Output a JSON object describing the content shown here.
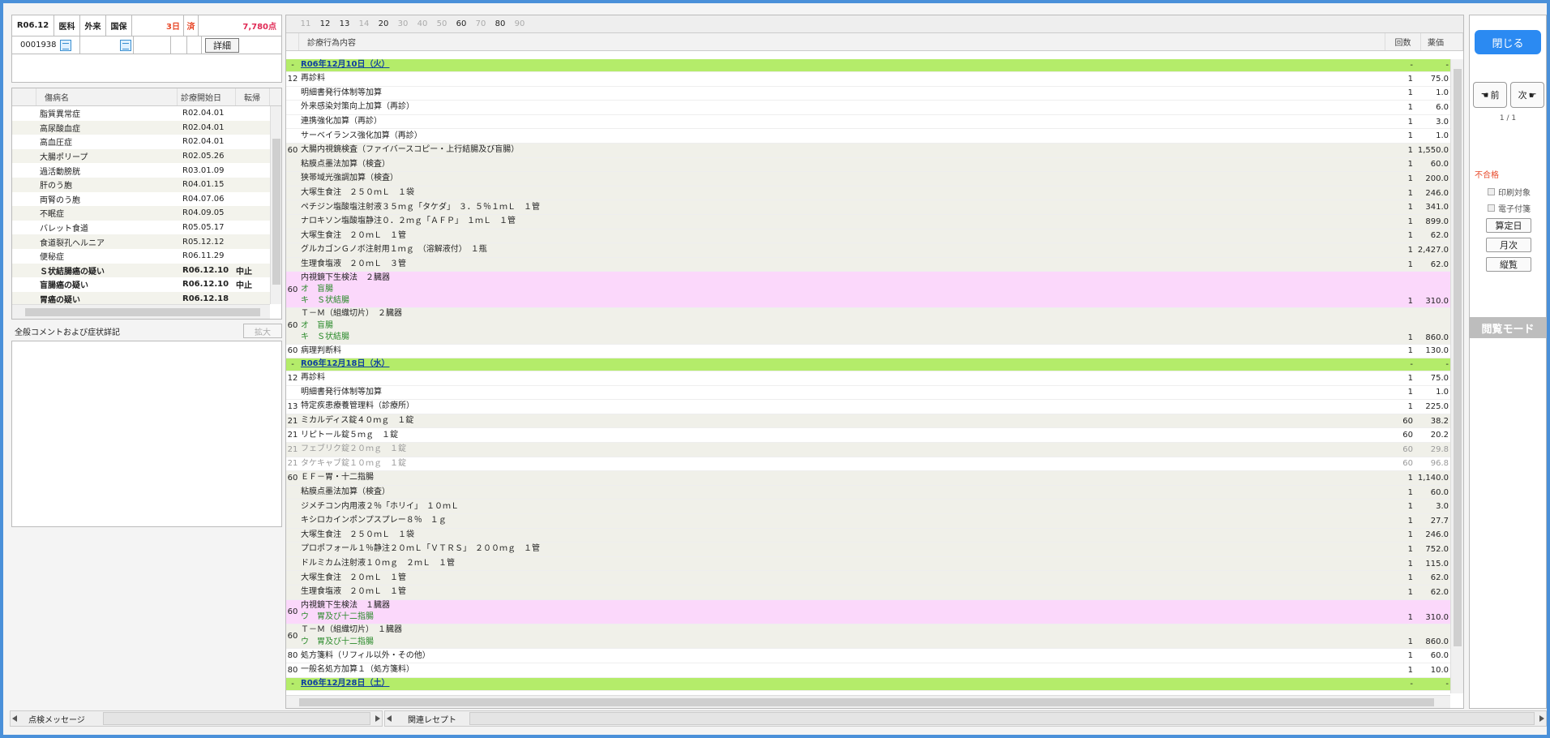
{
  "header": {
    "month": "R06.12",
    "type": "医科",
    "inout": "外来",
    "insurance": "国保",
    "days": "3日",
    "status": "済",
    "points": "7,780点",
    "patient_id": "0001938",
    "detail_label": "詳細"
  },
  "disease_table": {
    "headers": [
      "傷病名",
      "診療開始日",
      "転帰"
    ],
    "rows": [
      {
        "name": "脂質異常症",
        "date": "R02.04.01",
        "outcome": "",
        "bold": false
      },
      {
        "name": "高尿酸血症",
        "date": "R02.04.01",
        "outcome": "",
        "bold": false
      },
      {
        "name": "高血圧症",
        "date": "R02.04.01",
        "outcome": "",
        "bold": false
      },
      {
        "name": "大腸ポリープ",
        "date": "R02.05.26",
        "outcome": "",
        "bold": false
      },
      {
        "name": "過活動膀胱",
        "date": "R03.01.09",
        "outcome": "",
        "bold": false
      },
      {
        "name": "肝のう胞",
        "date": "R04.01.15",
        "outcome": "",
        "bold": false
      },
      {
        "name": "両腎のう胞",
        "date": "R04.07.06",
        "outcome": "",
        "bold": false
      },
      {
        "name": "不眠症",
        "date": "R04.09.05",
        "outcome": "",
        "bold": false
      },
      {
        "name": "バレット食道",
        "date": "R05.05.17",
        "outcome": "",
        "bold": false
      },
      {
        "name": "食道裂孔ヘルニア",
        "date": "R05.12.12",
        "outcome": "",
        "bold": false
      },
      {
        "name": "便秘症",
        "date": "R06.11.29",
        "outcome": "",
        "bold": false
      },
      {
        "name": "Ｓ状結腸癌の疑い",
        "date": "R06.12.10",
        "outcome": "中止",
        "bold": true
      },
      {
        "name": "盲腸癌の疑い",
        "date": "R06.12.10",
        "outcome": "中止",
        "bold": true
      },
      {
        "name": "胃癌の疑い",
        "date": "R06.12.18",
        "outcome": "",
        "bold": true
      }
    ]
  },
  "comment": {
    "label": "全般コメントおよび症状詳記",
    "expand_label": "拡大"
  },
  "bottom": {
    "check_message": "点検メッセージ",
    "related_receipt": "関連レセプト"
  },
  "months": [
    {
      "label": "11",
      "active": false
    },
    {
      "label": "12",
      "active": true
    },
    {
      "label": "13",
      "active": true
    },
    {
      "label": "14",
      "active": false
    },
    {
      "label": "20",
      "active": true
    },
    {
      "label": "30",
      "active": false
    },
    {
      "label": "40",
      "active": false
    },
    {
      "label": "50",
      "active": false
    },
    {
      "label": "60",
      "active": true
    },
    {
      "label": "70",
      "active": false
    },
    {
      "label": "80",
      "active": true
    },
    {
      "label": "90",
      "active": false
    }
  ],
  "content_table": {
    "headers": [
      "診療行為内容",
      "回数",
      "薬価"
    ],
    "rows": [
      {
        "kind": "date",
        "code": "-",
        "lines": [
          "R06年12月10日（火）"
        ],
        "count": "-",
        "value": "-"
      },
      {
        "kind": "normal",
        "code": "12",
        "lines": [
          "再診料"
        ],
        "count": "1",
        "value": "75.0"
      },
      {
        "kind": "normal",
        "code": "",
        "lines": [
          "明細書発行体制等加算"
        ],
        "count": "1",
        "value": "1.0"
      },
      {
        "kind": "normal",
        "code": "",
        "lines": [
          "外来感染対策向上加算（再診）"
        ],
        "count": "1",
        "value": "6.0"
      },
      {
        "kind": "normal",
        "code": "",
        "lines": [
          "連携強化加算（再診）"
        ],
        "count": "1",
        "value": "3.0"
      },
      {
        "kind": "normal",
        "code": "",
        "lines": [
          "サーベイランス強化加算（再診）"
        ],
        "count": "1",
        "value": "1.0"
      },
      {
        "kind": "alt",
        "code": "60",
        "lines": [
          "大腸内視鏡検査（ファイバースコピー・上行結腸及び盲腸）"
        ],
        "count": "1",
        "value": "1,550.0"
      },
      {
        "kind": "alt",
        "code": "",
        "lines": [
          "粘膜点墨法加算（検査）"
        ],
        "count": "1",
        "value": "60.0"
      },
      {
        "kind": "alt",
        "code": "",
        "lines": [
          "狭帯域光強調加算（検査）"
        ],
        "count": "1",
        "value": "200.0"
      },
      {
        "kind": "alt",
        "code": "",
        "lines": [
          "大塚生食注　２５０ｍＬ　１袋"
        ],
        "count": "1",
        "value": "246.0"
      },
      {
        "kind": "alt",
        "code": "",
        "lines": [
          "ペチジン塩酸塩注射液３５ｍｇ「タケダ」　３．５％１ｍＬ　１管"
        ],
        "count": "1",
        "value": "341.0"
      },
      {
        "kind": "alt",
        "code": "",
        "lines": [
          "ナロキソン塩酸塩静注０．２ｍｇ「ＡＦＰ」　１ｍＬ　１管"
        ],
        "count": "1",
        "value": "899.0"
      },
      {
        "kind": "alt",
        "code": "",
        "lines": [
          "大塚生食注　２０ｍＬ　１管"
        ],
        "count": "1",
        "value": "62.0"
      },
      {
        "kind": "alt",
        "code": "",
        "lines": [
          "グルカゴンＧノボ注射用１ｍｇ　（溶解液付）　１瓶"
        ],
        "count": "1",
        "value": "2,427.0"
      },
      {
        "kind": "alt",
        "code": "",
        "lines": [
          "生理食塩液　２０ｍＬ　３管"
        ],
        "count": "1",
        "value": "62.0"
      },
      {
        "kind": "pink",
        "code": "60",
        "lines": [
          "内視鏡下生検法　２臓器",
          "オ　盲腸",
          "キ　Ｓ状結腸"
        ],
        "count": "1",
        "value": "310.0"
      },
      {
        "kind": "alt",
        "code": "60",
        "lines": [
          "Ｔ－Ｍ（組織切片）　２臓器",
          "オ　盲腸",
          "キ　Ｓ状結腸"
        ],
        "count": "1",
        "value": "860.0"
      },
      {
        "kind": "normal",
        "code": "60",
        "lines": [
          "病理判断料"
        ],
        "count": "1",
        "value": "130.0"
      },
      {
        "kind": "date",
        "code": "-",
        "lines": [
          "R06年12月18日（水）"
        ],
        "count": "-",
        "value": "-"
      },
      {
        "kind": "normal",
        "code": "12",
        "lines": [
          "再診料"
        ],
        "count": "1",
        "value": "75.0"
      },
      {
        "kind": "normal",
        "code": "",
        "lines": [
          "明細書発行体制等加算"
        ],
        "count": "1",
        "value": "1.0"
      },
      {
        "kind": "normal",
        "code": "13",
        "lines": [
          "特定疾患療養管理料（診療所）"
        ],
        "count": "1",
        "value": "225.0"
      },
      {
        "kind": "alt",
        "code": "21",
        "lines": [
          "ミカルディス錠４０ｍｇ　１錠"
        ],
        "count": "60",
        "value": "38.2"
      },
      {
        "kind": "normal",
        "code": "21",
        "lines": [
          "リピトール錠５ｍｇ　１錠"
        ],
        "count": "60",
        "value": "20.2"
      },
      {
        "kind": "altgray",
        "code": "21",
        "lines": [
          "フェブリク錠２０ｍｇ　１錠"
        ],
        "count": "60",
        "value": "29.8"
      },
      {
        "kind": "gray",
        "code": "21",
        "lines": [
          "タケキャブ錠１０ｍｇ　１錠"
        ],
        "count": "60",
        "value": "96.8"
      },
      {
        "kind": "alt",
        "code": "60",
        "lines": [
          "ＥＦ－胃・十二指腸"
        ],
        "count": "1",
        "value": "1,140.0"
      },
      {
        "kind": "alt",
        "code": "",
        "lines": [
          "粘膜点墨法加算（検査）"
        ],
        "count": "1",
        "value": "60.0"
      },
      {
        "kind": "alt",
        "code": "",
        "lines": [
          "ジメチコン内用液２％「ホリイ」　１０ｍＬ"
        ],
        "count": "1",
        "value": "3.0"
      },
      {
        "kind": "alt",
        "code": "",
        "lines": [
          "キシロカインポンプスプレー８％　１ｇ"
        ],
        "count": "1",
        "value": "27.7"
      },
      {
        "kind": "alt",
        "code": "",
        "lines": [
          "大塚生食注　２５０ｍＬ　１袋"
        ],
        "count": "1",
        "value": "246.0"
      },
      {
        "kind": "alt",
        "code": "",
        "lines": [
          "プロポフォール１％静注２０ｍＬ「ＶＴＲＳ」　２００ｍｇ　１管"
        ],
        "count": "1",
        "value": "752.0"
      },
      {
        "kind": "alt",
        "code": "",
        "lines": [
          "ドルミカム注射液１０ｍｇ　２ｍＬ　１管"
        ],
        "count": "1",
        "value": "115.0"
      },
      {
        "kind": "alt",
        "code": "",
        "lines": [
          "大塚生食注　２０ｍＬ　１管"
        ],
        "count": "1",
        "value": "62.0"
      },
      {
        "kind": "alt",
        "code": "",
        "lines": [
          "生理食塩液　２０ｍＬ　１管"
        ],
        "count": "1",
        "value": "62.0"
      },
      {
        "kind": "pink",
        "code": "60",
        "lines": [
          "内視鏡下生検法　１臓器",
          "ウ　胃及び十二指腸"
        ],
        "count": "1",
        "value": "310.0"
      },
      {
        "kind": "alt",
        "code": "60",
        "lines": [
          "Ｔ－Ｍ（組織切片）　１臓器",
          "ウ　胃及び十二指腸"
        ],
        "count": "1",
        "value": "860.0"
      },
      {
        "kind": "normal",
        "code": "80",
        "lines": [
          "処方箋料（リフィル以外・その他）"
        ],
        "count": "1",
        "value": "60.0"
      },
      {
        "kind": "normal",
        "code": "80",
        "lines": [
          "一般名処方加算１（処方箋料）"
        ],
        "count": "1",
        "value": "10.0"
      },
      {
        "kind": "date",
        "code": "-",
        "lines": [
          "R06年12月28日（土）"
        ],
        "count": "-",
        "value": "-"
      }
    ]
  },
  "right_panel": {
    "close_label": "閉じる",
    "prev_label": "前",
    "next_label": "次",
    "page_indicator": "1 / 1",
    "status_text": "不合格",
    "print_target": "印刷対象",
    "electronic_attach": "電子付箋",
    "calc_date": "算定日",
    "monthly": "月次",
    "vertical_view": "縦覧",
    "mode_label": "閲覧モード"
  },
  "colors": {
    "frame": "#4a90d9",
    "date_row": "#b4ec6a",
    "pink_row": "#fbd8fb",
    "close_button": "#2b8af2",
    "status_red": "#e84b2c",
    "points_red": "#e02a55"
  }
}
